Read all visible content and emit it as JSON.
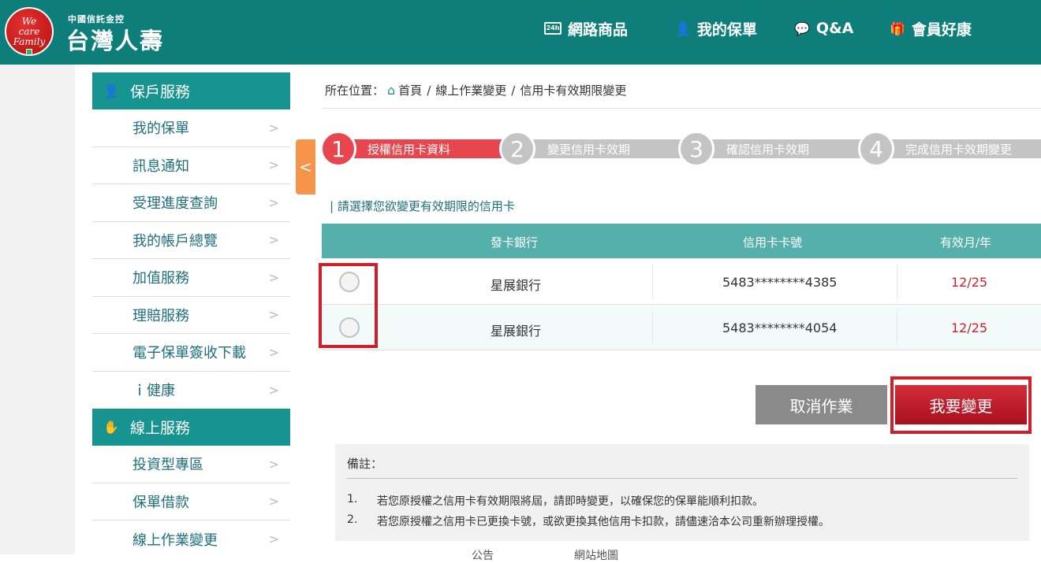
{
  "header": {
    "logo_circle_text": [
      "We",
      "care",
      "Family"
    ],
    "logo_sub": "中國信託金控",
    "logo_main": "台灣人壽",
    "nav": [
      {
        "label": "網路商品",
        "icon": "24h-laptop-icon",
        "icon_text": "24h"
      },
      {
        "label": "我的保單",
        "icon": "person-icon"
      },
      {
        "label": "Q&A",
        "icon": "chat-bubble-icon"
      },
      {
        "label": "會員好康",
        "icon": "gift-icon"
      }
    ]
  },
  "sidebar": {
    "group1_title": "保戶服務",
    "group1_items": [
      "我的保單",
      "訊息通知",
      "受理進度查詢",
      "我的帳戶總覽",
      "加值服務",
      "理賠服務",
      "電子保單簽收下載",
      "ｉ健康"
    ],
    "group2_title": "線上服務",
    "group2_items": [
      "投資型專區",
      "保單借款",
      "線上作業變更"
    ]
  },
  "breadcrumb": {
    "prefix": "所在位置：",
    "home": "首頁",
    "sep": "/",
    "level2": "線上作業變更",
    "level3": "信用卡有效期限變更"
  },
  "steps": [
    {
      "num": "1",
      "label": "授權信用卡資料",
      "active": true
    },
    {
      "num": "2",
      "label": "變更信用卡效期",
      "active": false
    },
    {
      "num": "3",
      "label": "確認信用卡效期",
      "active": false
    },
    {
      "num": "4",
      "label": "完成信用卡效期變更",
      "active": false
    }
  ],
  "section_title": "| 請選擇您欲變更有效期限的信用卡",
  "table": {
    "headers": [
      "發卡銀行",
      "信用卡卡號",
      "有效月/年"
    ],
    "rows": [
      {
        "bank": "星展銀行",
        "card": "5483********4385",
        "expiry": "12/25"
      },
      {
        "bank": "星展銀行",
        "card": "5483********4054",
        "expiry": "12/25"
      }
    ]
  },
  "buttons": {
    "cancel": "取消作業",
    "change": "我要變更"
  },
  "notes": {
    "title": "備註：",
    "items": [
      {
        "num": "1.",
        "text": "若您原授權之信用卡有效期限將屆，請即時變更，以確保您的保單能順利扣款。"
      },
      {
        "num": "2.",
        "text": "若您原授權之信用卡已更換卡號，或欲更換其他信用卡扣款，請儘速洽本公司重新辦理授權。"
      }
    ]
  },
  "bottom_cut": [
    "公告",
    "網站地圖"
  ],
  "colors": {
    "header": "#0e7e7b",
    "sidebar_head": "#17948f",
    "table_head": "#55b0ab",
    "step_active": "#e8454f",
    "step_inactive": "#c4c4c4",
    "primary_button": "#c21e2c",
    "expiry_text": "#c8202c",
    "highlight_box": "#d11f2a"
  }
}
